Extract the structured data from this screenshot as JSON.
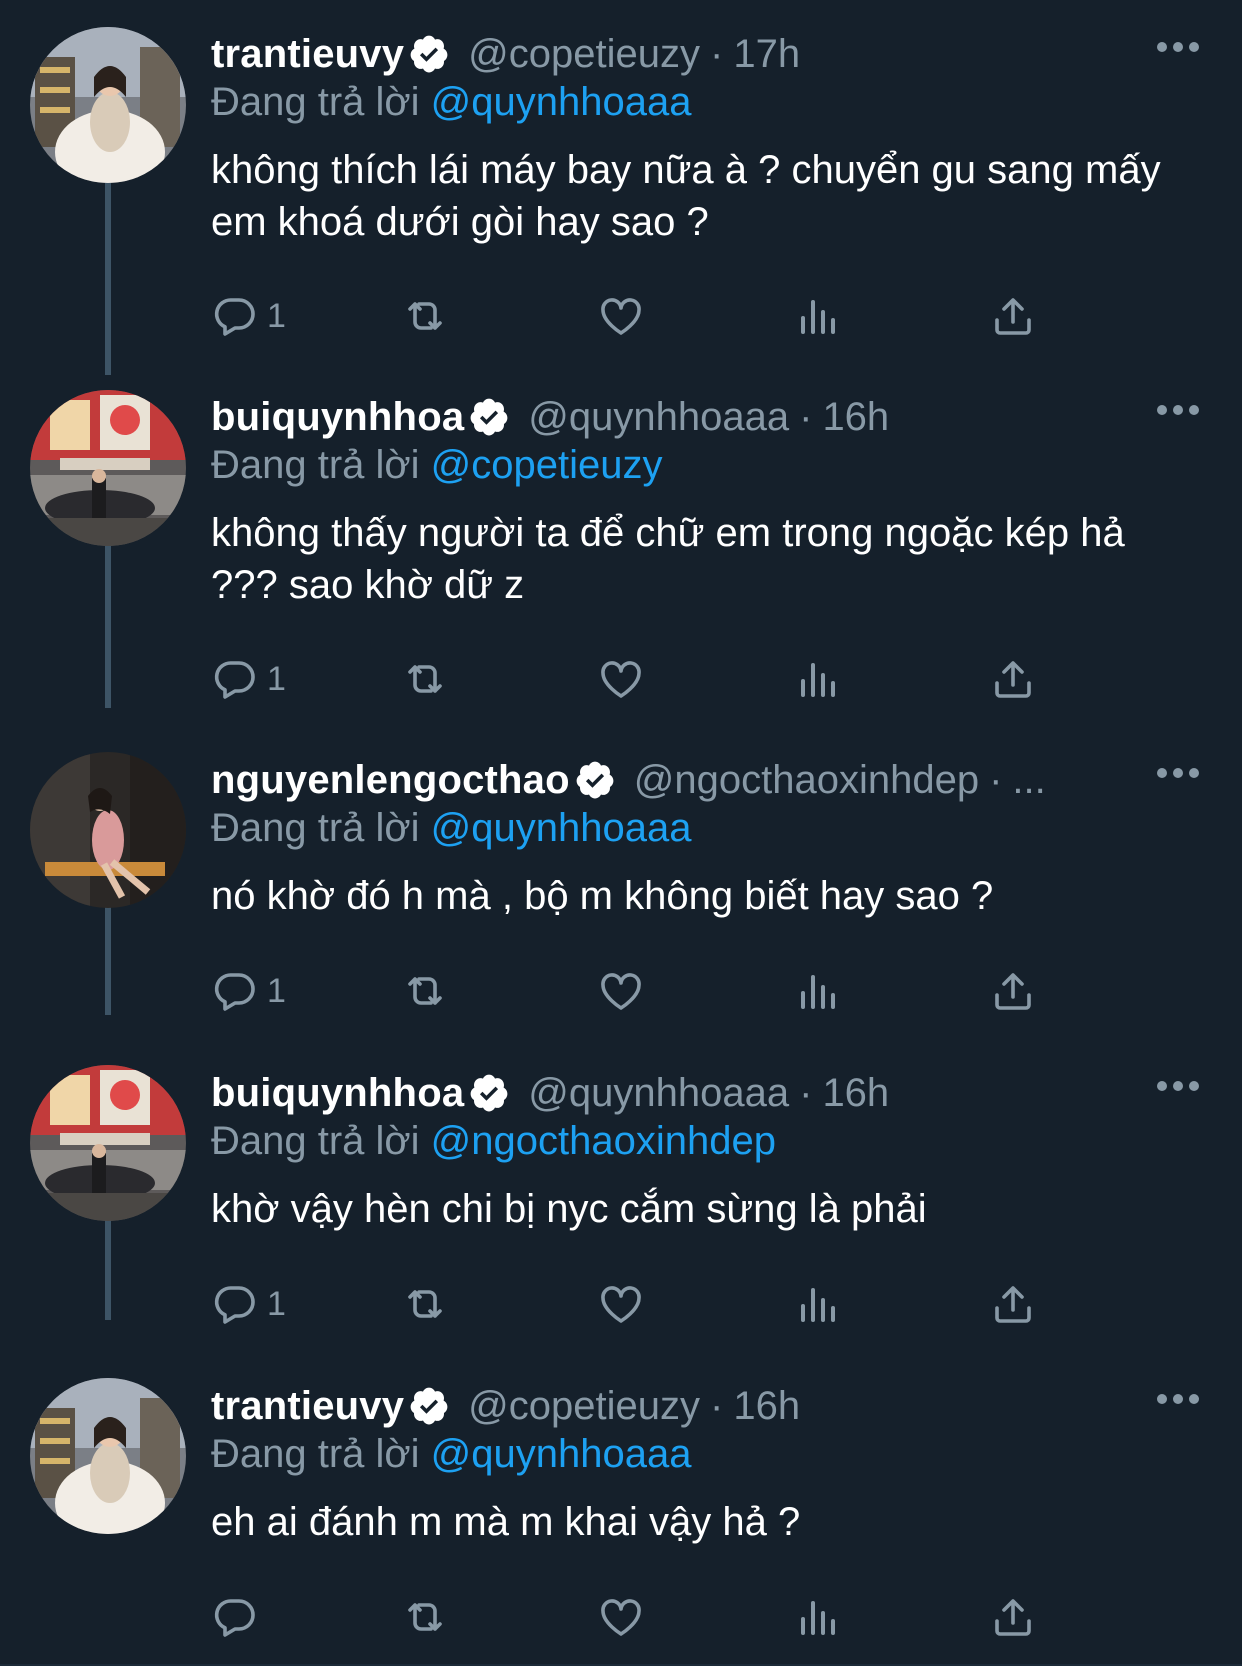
{
  "colors": {
    "background": "#15202b",
    "primary_text": "#ffffff",
    "secondary_text": "#8899a6",
    "link": "#1da1f2",
    "thread_line": "#3d5466"
  },
  "tweets": [
    {
      "display_name": "trantieuvy",
      "verified": true,
      "handle": "@copetieuzy",
      "separator": "·",
      "time": "17h",
      "reply_prefix": "Đang trả lời",
      "reply_to": "@quynhhoaaa",
      "text": "không thích lái máy bay nữa à ? chuyển gu sang mấy em khoá dưới gòi hay sao ?",
      "reply_count": "1",
      "avatar": "avatar-trantieuvy"
    },
    {
      "display_name": "buiquynhhoa",
      "verified": true,
      "handle": "@quynhhoaaa",
      "separator": "·",
      "time": "16h",
      "reply_prefix": "Đang trả lời",
      "reply_to": "@copetieuzy",
      "text": "không thấy người ta để chữ em trong ngoặc kép hả ??? sao khờ dữ z",
      "reply_count": "1",
      "avatar": "avatar-buiquynhhoa"
    },
    {
      "display_name": "nguyenlengocthao",
      "verified": true,
      "handle": "@ngocthaoxinhdep",
      "separator": "·",
      "time": "...",
      "reply_prefix": "Đang trả lời",
      "reply_to": "@quynhhoaaa",
      "text": "nó khờ đó h mà , bộ m không biết hay sao ?",
      "reply_count": "1",
      "avatar": "avatar-nguyenlengocthao"
    },
    {
      "display_name": "buiquynhhoa",
      "verified": true,
      "handle": "@quynhhoaaa",
      "separator": "·",
      "time": "16h",
      "reply_prefix": "Đang trả lời",
      "reply_to": "@ngocthaoxinhdep",
      "text": "khờ vậy hèn chi bị nyc cắm sừng là phải",
      "reply_count": "1",
      "avatar": "avatar-buiquynhhoa"
    },
    {
      "display_name": "trantieuvy",
      "verified": true,
      "handle": "@copetieuzy",
      "separator": "·",
      "time": "16h",
      "reply_prefix": "Đang trả lời",
      "reply_to": "@quynhhoaaa",
      "text": "eh ai đánh m mà m khai vậy hả ?",
      "reply_count": "",
      "avatar": "avatar-trantieuvy"
    }
  ],
  "icons": {
    "verified": "verified-badge-icon",
    "more": "more-options-icon",
    "reply": "reply-icon",
    "retweet": "retweet-icon",
    "like": "like-icon",
    "views": "views-icon",
    "share": "share-icon"
  }
}
